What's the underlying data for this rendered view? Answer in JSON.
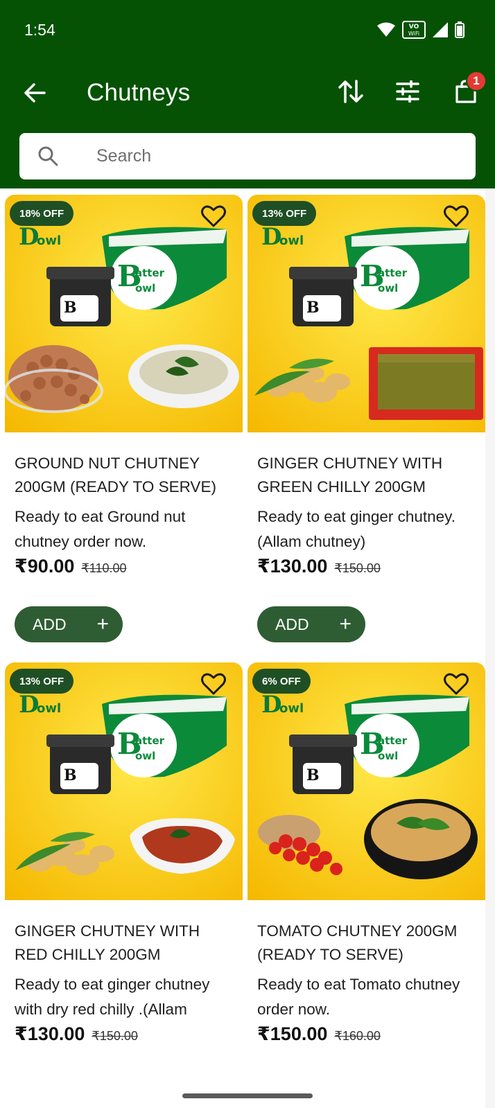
{
  "status_bar": {
    "time": "1:54",
    "icons": [
      "wifi-icon",
      "vowifi-icon",
      "signal-icon",
      "battery-icon"
    ],
    "vowifi_text_top": "VO",
    "vowifi_text_bottom": "WiFi"
  },
  "app_bar": {
    "title": "Chutneys",
    "cart_count": "1",
    "icons": [
      "back-arrow-icon",
      "sort-icon",
      "filter-icon",
      "cart-icon"
    ]
  },
  "search": {
    "placeholder": "Search",
    "value": ""
  },
  "products": [
    {
      "discount": "18% OFF",
      "name": "GROUND NUT CHUTNEY 200GM (READY TO SERVE)",
      "description": "Ready to eat Ground nut chutney order now.",
      "price": "₹90.00",
      "mrp": "₹110.00",
      "add_label": "ADD",
      "add_icon": "+",
      "image": "groundnut-chutney-image"
    },
    {
      "discount": "13% OFF",
      "name": "GINGER CHUTNEY WITH GREEN CHILLY 200GM",
      "description": "Ready to eat ginger chutney. (Allam chutney)",
      "price": "₹130.00",
      "mrp": "₹150.00",
      "add_label": "ADD",
      "add_icon": "+",
      "image": "ginger-green-chutney-image"
    },
    {
      "discount": "13% OFF",
      "name": "GINGER CHUTNEY WITH RED CHILLY 200GM",
      "description": "Ready to eat ginger chutney with dry red chilly .(Allam",
      "price": "₹130.00",
      "mrp": "₹150.00",
      "image": "ginger-red-chutney-image"
    },
    {
      "discount": "6% OFF",
      "name": "TOMATO CHUTNEY 200GM (READY TO SERVE)",
      "description": "Ready to eat Tomato chutney order now.",
      "price": "₹150.00",
      "mrp": "₹160.00",
      "image": "tomato-chutney-image"
    }
  ],
  "brand": {
    "logo_text_1": "atter",
    "logo_text_2": "owl",
    "colors": {
      "header": "#055205",
      "button": "#2f5d33",
      "badge": "#1f4f24",
      "image_bg": "#f7c400",
      "pack": "#0b8a3a"
    }
  }
}
